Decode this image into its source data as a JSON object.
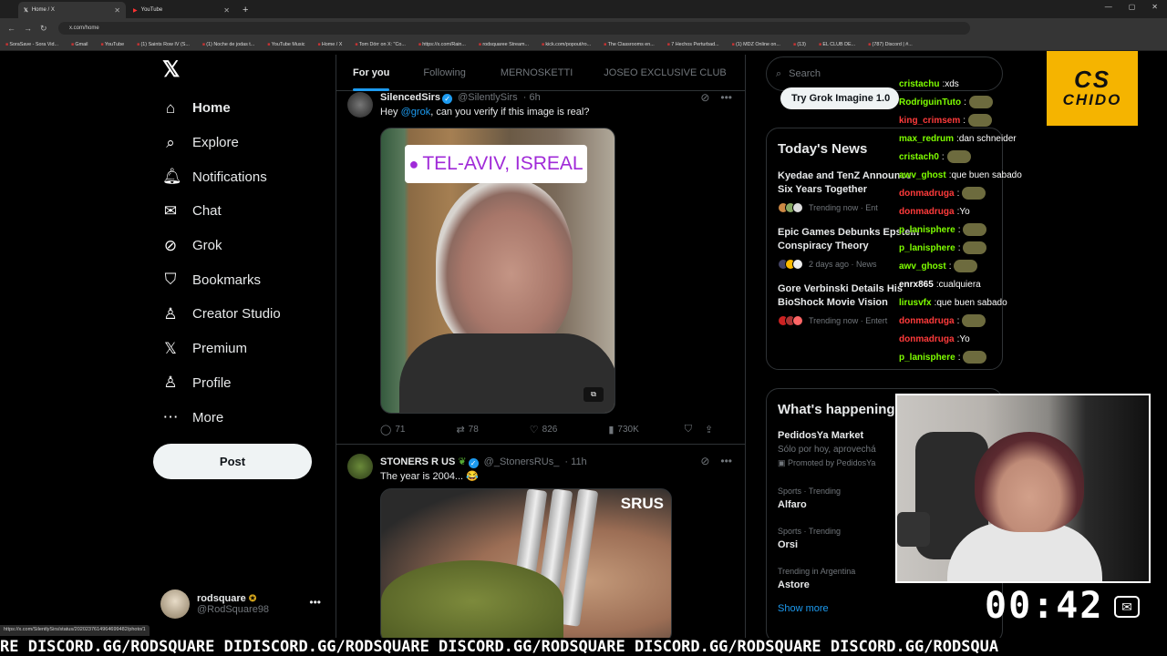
{
  "browser": {
    "tabs": [
      {
        "title": "Home / X",
        "icon": "x-logo"
      },
      {
        "title": "YouTube",
        "icon": "youtube-logo"
      }
    ],
    "url": "x.com/home",
    "bookmarks": [
      "SoraSave - Sora Vid...",
      "Gmail",
      "YouTube",
      "(1) Saints Row IV (S...",
      "(1) Noche de jodas t...",
      "YouTube Music",
      "Home / X",
      "Tom Dörr on X: \"Co...",
      "https://x.com/Rain...",
      "rodsquaree Stream...",
      "kick.com/popout/ro...",
      "The Classrooms en...",
      "7 Hechos Perturbad...",
      "(1) MDZ Online on...",
      "(13)",
      "EL CLUB DE...",
      "(787) Discord | #..."
    ],
    "status_url": "https://x.com/SilentlySirs/status/2020237614964699482/photo/1"
  },
  "nav": {
    "items": [
      {
        "label": "Home",
        "icon": "home-icon"
      },
      {
        "label": "Explore",
        "icon": "search-icon"
      },
      {
        "label": "Notifications",
        "icon": "bell-icon"
      },
      {
        "label": "Chat",
        "icon": "mail-icon"
      },
      {
        "label": "Grok",
        "icon": "grok-icon"
      },
      {
        "label": "Bookmarks",
        "icon": "bookmark-icon"
      },
      {
        "label": "Creator Studio",
        "icon": "creator-icon"
      },
      {
        "label": "Premium",
        "icon": "x-icon"
      },
      {
        "label": "Profile",
        "icon": "person-icon"
      },
      {
        "label": "More",
        "icon": "more-circle-icon"
      }
    ],
    "post_label": "Post",
    "account": {
      "name": "rodsquare",
      "handle": "@RodSquare98"
    }
  },
  "feed": {
    "tabs": [
      "For you",
      "Following",
      "MERNOSKETTI",
      "JOSEO EXCLUSIVE CLUB"
    ],
    "tweets": [
      {
        "name": "SilencedSirs",
        "handle": "@SilentlySirs",
        "time": "· 6h",
        "text_prefix": "Hey ",
        "mention": "@grok",
        "text_suffix": ", can you verify if this image is real?",
        "image_caption": "TEL-AVIV, ISREAL",
        "replies": "71",
        "reposts": "78",
        "likes": "826",
        "views": "730K"
      },
      {
        "name": "STONERS R US",
        "handle": "@_StonersRUs_",
        "time": "· 11h",
        "text": "The year is 2004... 😂",
        "image_caption": "SRUS"
      }
    ]
  },
  "sidebar": {
    "search_placeholder": "Search",
    "grok_pill": "Try Grok Imagine 1.0",
    "news_title": "Today's News",
    "news": [
      {
        "title": "Kyedae and TenZ Announce",
        "title2": "Six Years Together",
        "meta": "Trending now · Ent"
      },
      {
        "title": "Epic Games Debunks Epstein",
        "title2": "Conspiracy Theory",
        "meta": "2 days ago · News"
      },
      {
        "title": "Gore Verbinski Details His",
        "title2": "BioShock Movie Vision",
        "meta": "Trending now · Entert"
      }
    ],
    "trends_title": "What's happening",
    "trends": [
      {
        "cat": "",
        "name": "PedidosYa Market",
        "sub": "Sólo por hoy, aprovechá",
        "promo": "Promoted by PedidosYa"
      },
      {
        "cat": "Sports · Trending",
        "name": "Alfaro",
        "sub": "",
        "promo": ""
      },
      {
        "cat": "Sports · Trending",
        "name": "Orsi",
        "sub": "",
        "promo": ""
      },
      {
        "cat": "Trending in Argentina",
        "name": "Astore",
        "sub": "",
        "promo": ""
      }
    ],
    "show_more": "Show more"
  },
  "stream": {
    "chat": [
      {
        "user": "cristachu",
        "text": "xds",
        "color": "#7fff00"
      },
      {
        "user": "RodriguinTuto",
        "text": "",
        "color": "#7fff00",
        "emote": true
      },
      {
        "user": "king_crimsem",
        "text": "",
        "color": "#ff3b3b",
        "emote": true
      },
      {
        "user": "max_redrum",
        "text": "dan schneider",
        "color": "#7fff00"
      },
      {
        "user": "cristach0",
        "text": "",
        "color": "#7fff00",
        "emote": true
      },
      {
        "user": "awv_ghost",
        "text": "que buen sabado",
        "color": "#7fff00"
      },
      {
        "user": "donmadruga",
        "text": "",
        "color": "#ff3b3b",
        "emote": true
      },
      {
        "user": "donmadruga",
        "text": "Yo",
        "color": "#ff3b3b"
      },
      {
        "user": "p_lanisphere",
        "text": "",
        "color": "#7fff00",
        "emote": true
      },
      {
        "user": "p_lanisphere",
        "text": "",
        "color": "#7fff00",
        "emote": true
      },
      {
        "user": "awv_ghost",
        "text": "",
        "color": "#7fff00",
        "emote": true
      },
      {
        "user": "enrx865",
        "text": "cualquiera",
        "color": "#ffffff"
      },
      {
        "user": "lirusvfx",
        "text": "que buen sabado",
        "color": "#7fff00"
      },
      {
        "user": "donmadruga",
        "text": "",
        "color": "#ff3b3b",
        "emote": true
      },
      {
        "user": "donmadruga",
        "text": "Yo",
        "color": "#ff3b3b"
      },
      {
        "user": "p_lanisphere",
        "text": "",
        "color": "#7fff00",
        "emote": true
      }
    ],
    "logo_top": "CS",
    "logo_bottom": "CHIDO",
    "timer": "00:42",
    "ticker": "RE DISCORD.GG/RODSQUARE DIDISCORD.GG/RODSQUARE DISCORD.GG/RODSQUARE DISCORD.GG/RODSQUARE DISCORD.GG/RODSQUA"
  }
}
